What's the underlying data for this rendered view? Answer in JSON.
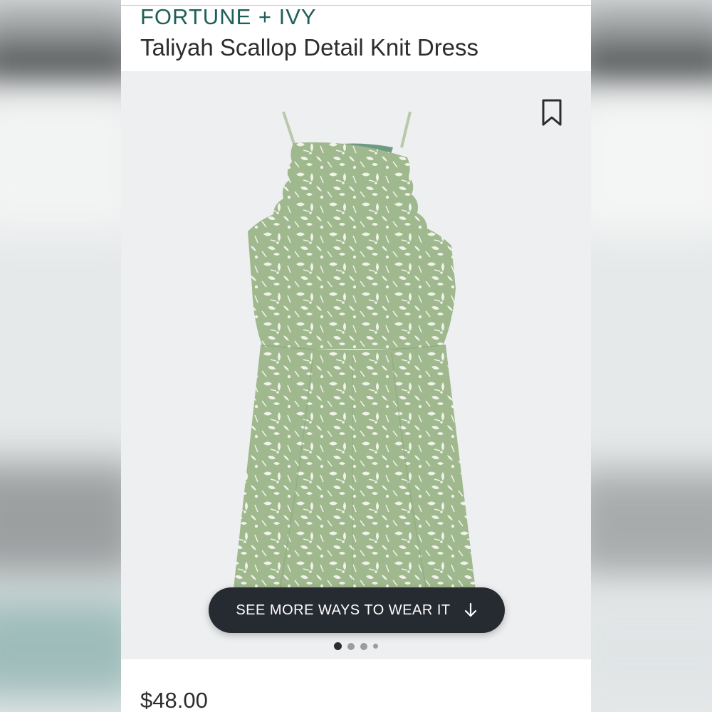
{
  "product": {
    "brand": "FORTUNE + IVY",
    "name": "Taliyah Scallop Detail Knit Dress",
    "price": "$48.00",
    "image_description_icon": "dress-image"
  },
  "actions": {
    "see_more_label": "SEE MORE WAYS TO WEAR IT",
    "see_more_icon": "arrow-down-icon",
    "bookmark_icon": "bookmark-icon"
  },
  "carousel": {
    "total_dots": 4,
    "active_index": 0
  },
  "colors": {
    "brand": "#1f5f5b",
    "dress": "#9fb88e",
    "button": "#262a31"
  }
}
